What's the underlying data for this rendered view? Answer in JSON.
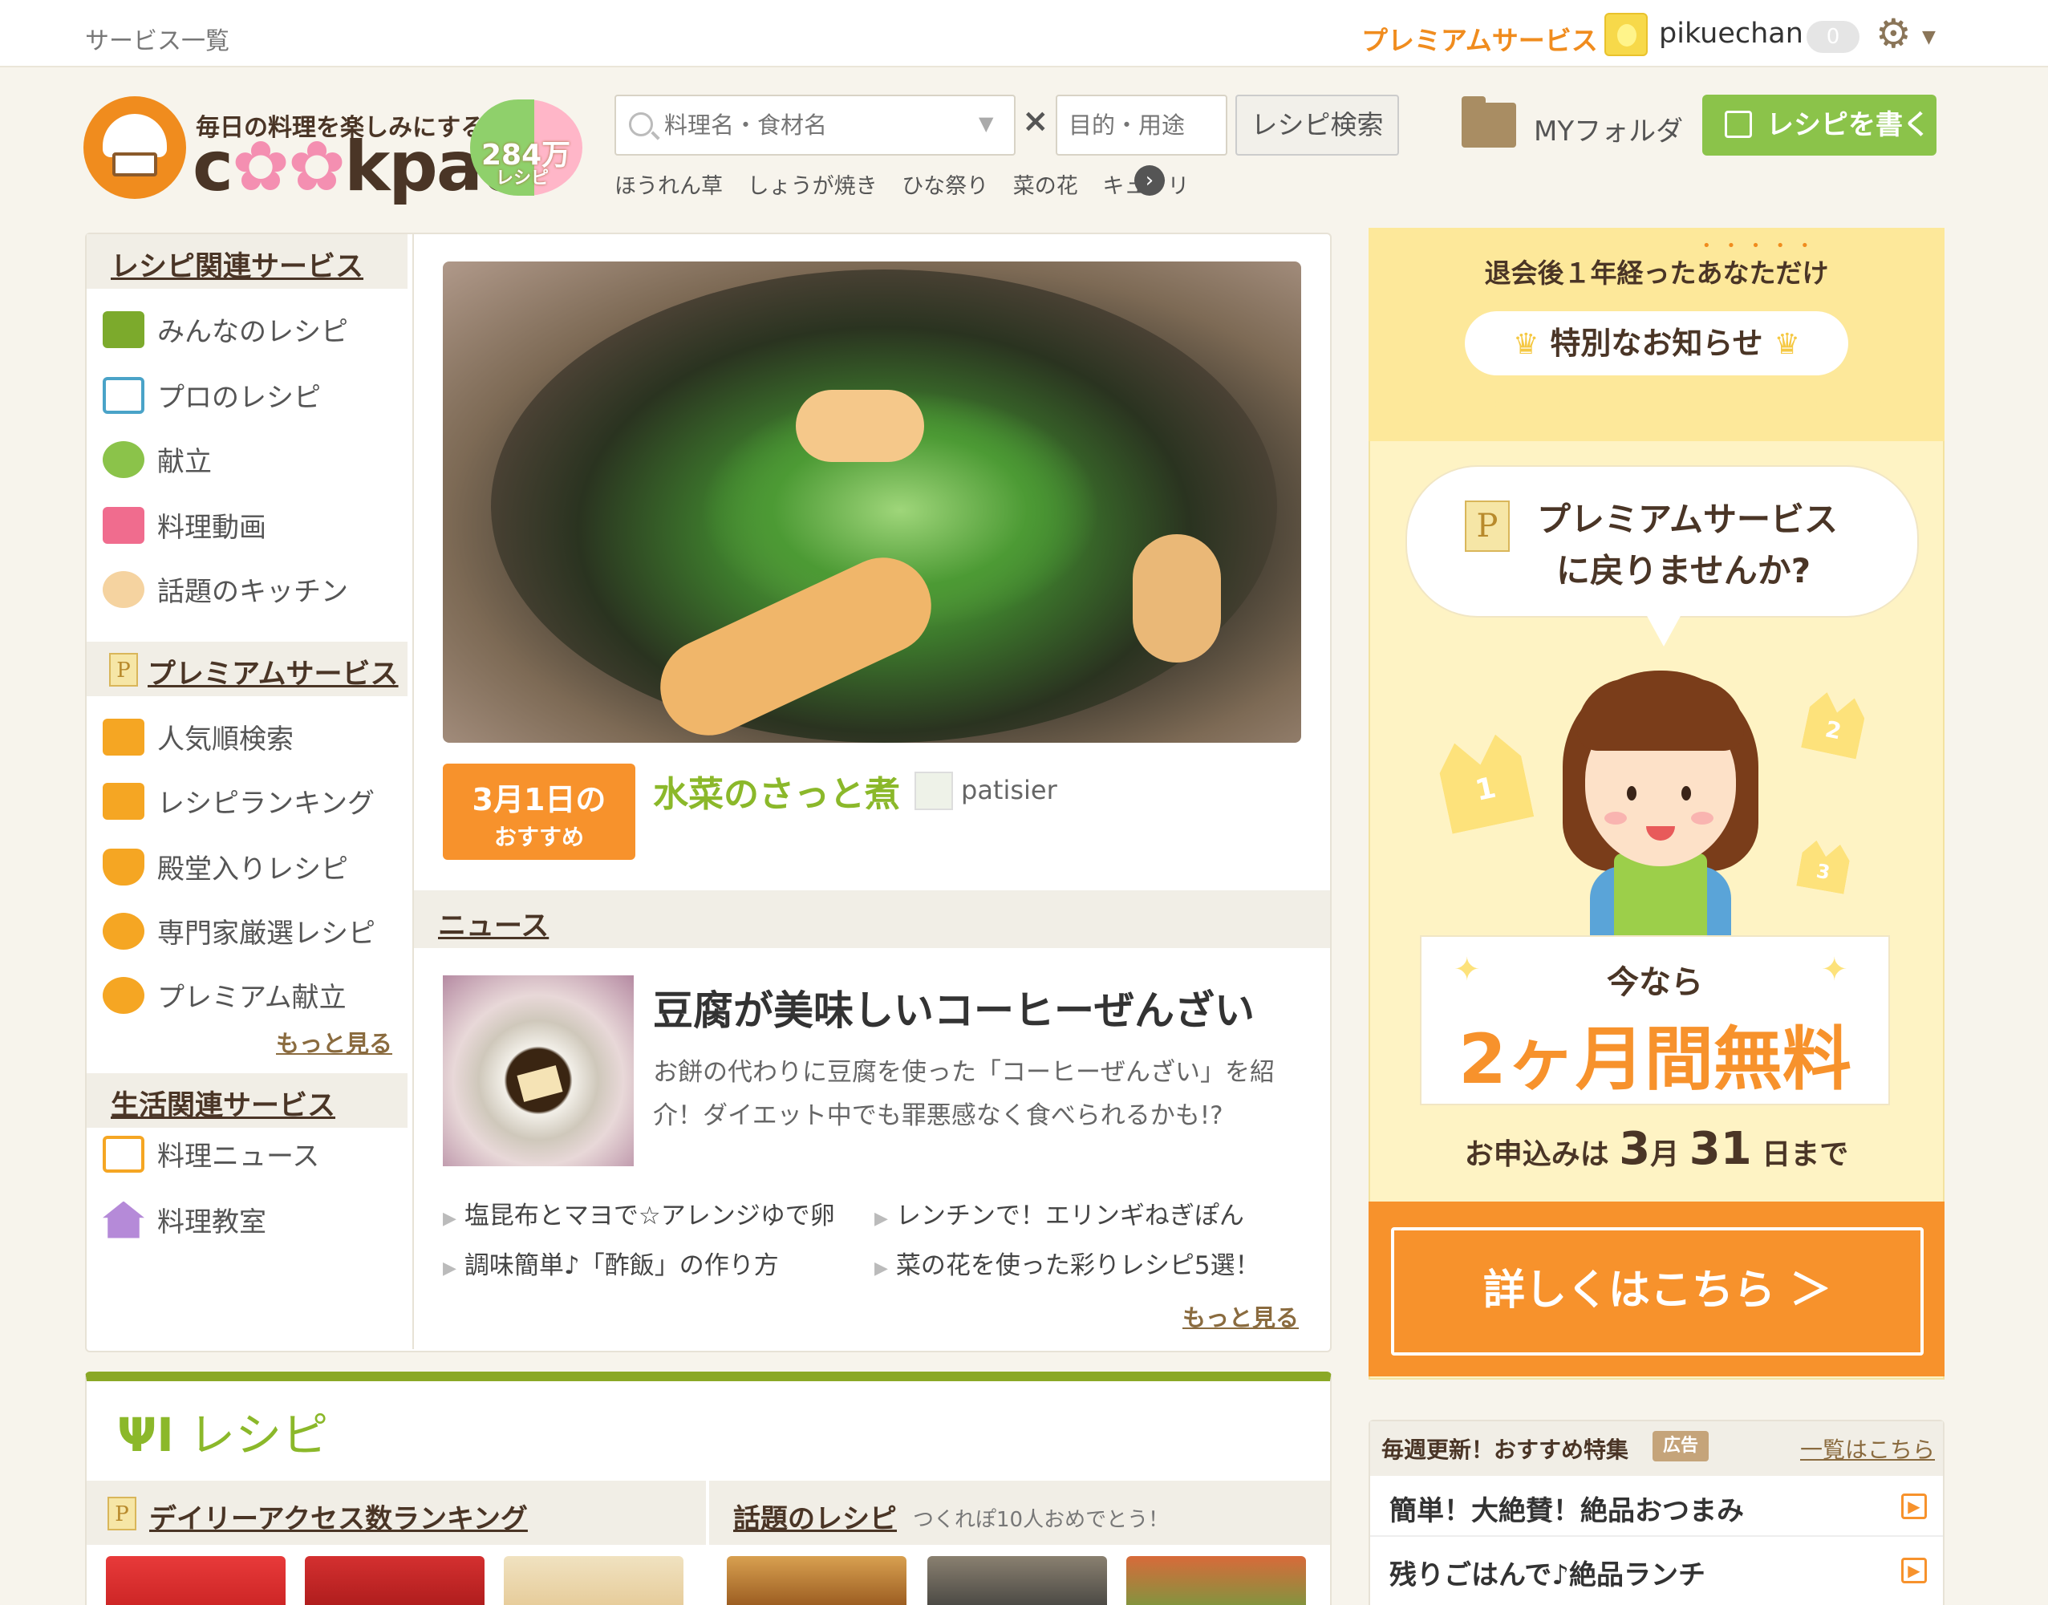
{
  "topbar": {
    "services_label": "サービス一覧",
    "premium_label": "プレミアムサービス",
    "username": "pikuechan",
    "notification_count": "0"
  },
  "logo": {
    "tagline": "毎日の料理を楽しみにする",
    "brand_pre": "c",
    "brand_post": "kpad",
    "count": "284万",
    "count_label": "レシピ"
  },
  "search": {
    "keyword_placeholder": "料理名・食材名",
    "clear_label": "×",
    "purpose_placeholder": "目的・用途",
    "button_label": "レシピ検索",
    "popular": [
      "ほうれん草",
      "しょうが焼き",
      "ひな祭り",
      "菜の花",
      "キュウリ"
    ]
  },
  "header_actions": {
    "myfolder_label": "MYフォルダ",
    "write_label": "レシピを書く"
  },
  "sidebar": {
    "section1_title": "レシピ関連サービス",
    "section1_items": [
      {
        "label": "みんなのレシピ",
        "icon": "fork-knife-icon"
      },
      {
        "label": "プロのレシピ",
        "icon": "book-icon"
      },
      {
        "label": "献立",
        "icon": "bowls-icon"
      },
      {
        "label": "料理動画",
        "icon": "video-camera-icon"
      },
      {
        "label": "話題のキッチン",
        "icon": "chef-icon"
      }
    ],
    "section2_title": "プレミアムサービス",
    "section2_badge": "P",
    "section2_items": [
      {
        "label": "人気順検索",
        "icon": "crown-icon"
      },
      {
        "label": "レシピランキング",
        "icon": "podium-icon"
      },
      {
        "label": "殿堂入りレシピ",
        "icon": "trophy-icon"
      },
      {
        "label": "専門家厳選レシピ",
        "icon": "expert-icon"
      },
      {
        "label": "プレミアム献立",
        "icon": "star-hand-icon"
      }
    ],
    "more_label": "もっと見る",
    "section3_title": "生活関連サービス",
    "section3_items": [
      {
        "label": "料理ニュース",
        "icon": "newspaper-icon"
      },
      {
        "label": "料理教室",
        "icon": "house-icon"
      }
    ]
  },
  "featured": {
    "date_main": "3月1日の",
    "date_sub": "おすすめ",
    "title": "水菜のさっと煮",
    "author": "patisier"
  },
  "news": {
    "section_title": "ニュース",
    "headline": "豆腐が美味しいコーヒーぜんざい",
    "description": "お餅の代わりに豆腐を使った「コーヒーぜんざい」を紹介！ダイエット中でも罪悪感なく食べられるかも!?",
    "links": [
      "塩昆布とマヨで☆アレンジゆで卵",
      "レンチンで！エリンギねぎぽん",
      "調味簡単♪「酢飯」の作り方",
      "菜の花を使った彩りレシピ5選！"
    ],
    "more_label": "もっと見る"
  },
  "recipe_section": {
    "title": "レシピ",
    "ranking_badge": "P",
    "ranking_title": "デイリーアクセス数ランキング",
    "topic_title": "話題のレシピ",
    "topic_note": "つくれぽ10人おめでとう！"
  },
  "premium_ad": {
    "sub_label": "退会後１年経ったあなただけ",
    "pill_label": "特別なお知らせ",
    "bubble_badge": "P",
    "bubble_line1": "プレミアムサービス",
    "bubble_line2": "に戻りませんか?",
    "crown_numbers": [
      "1",
      "2",
      "3"
    ],
    "now_label": "今なら",
    "free_label": "2ヶ月間無料",
    "deadline_pre": "お申込みは",
    "deadline_month": "3",
    "deadline_month_unit": "月",
    "deadline_day": "31",
    "deadline_post": "日まで",
    "cta_label": "詳しくはこちら ＞"
  },
  "weekly_feature": {
    "title": "毎週更新！おすすめ特集",
    "ad_badge": "広告",
    "all_label": "一覧はこちら",
    "items": [
      "簡単！大絶賛！絶品おつまみ",
      "残りごはんで♪絶品ランチ"
    ]
  },
  "colors": {
    "accent_orange": "#f7922c",
    "accent_green": "#8bc34a",
    "brand_brown": "#4a3526",
    "background": "#f7f4ec"
  }
}
